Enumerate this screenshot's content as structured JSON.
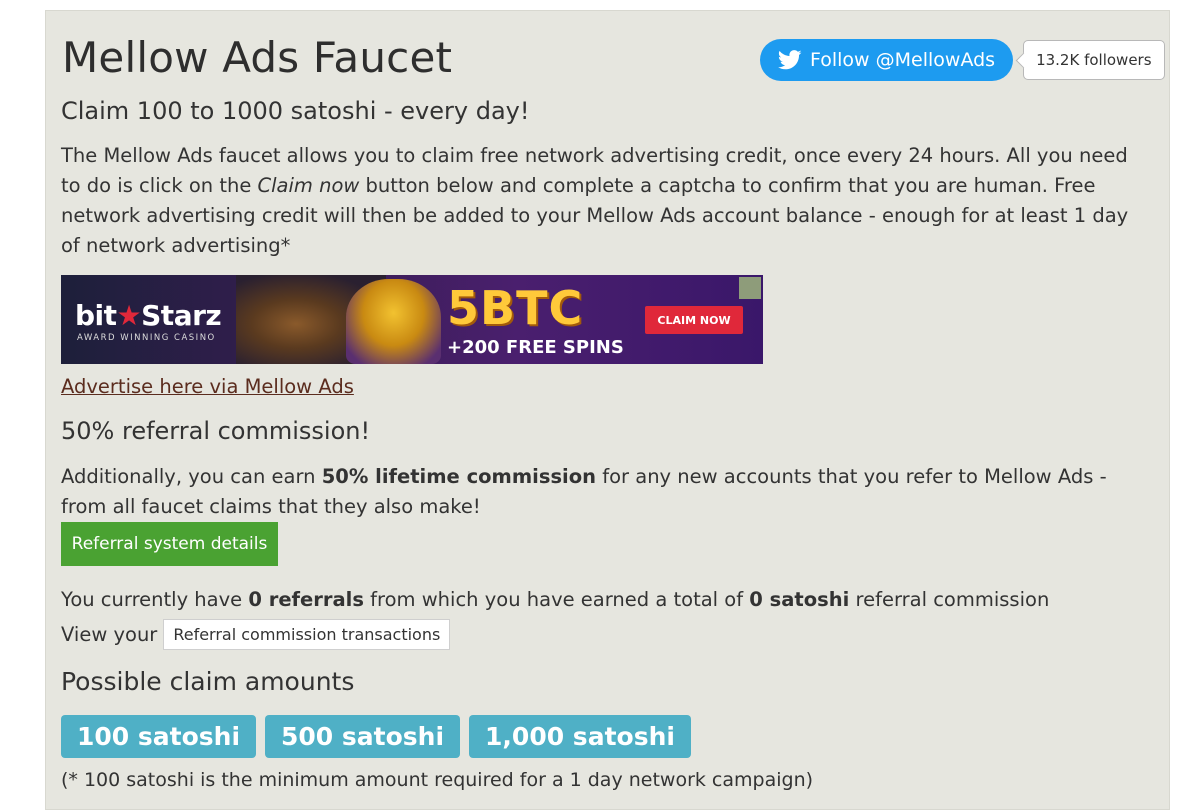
{
  "page": {
    "title": "Mellow Ads Faucet",
    "subtitle": "Claim 100 to 1000 satoshi - every day!"
  },
  "twitter": {
    "follow_label": "Follow @MellowAds",
    "followers": "13.2K followers",
    "icon": "twitter-bird-icon",
    "color": "#1d9bf0"
  },
  "intro": {
    "part1": "The Mellow Ads faucet allows you to claim free network advertising credit, once every 24 hours. All you need to do is click on the ",
    "claim_now": "Claim now",
    "part2": " button below and complete a captcha to confirm that you are human. Free network advertising credit will then be added to your Mellow Ads account balance - enough for at least 1 day of network advertising*"
  },
  "banner": {
    "brand_part1": "bit",
    "brand_star": "★",
    "brand_part2": "Starz",
    "tagline": "AWARD WINNING CASINO",
    "headline": "5BTC",
    "subline": "+200 FREE SPINS",
    "cta": "CLAIM NOW"
  },
  "advertise_link": "Advertise here via Mellow Ads",
  "referral": {
    "heading": "50% referral commission!",
    "text_before": "Additionally, you can earn ",
    "text_bold": "50% lifetime commission",
    "text_after": " for any new accounts that you refer to Mellow Ads - from all faucet claims that they also make!",
    "details_button": "Referral system details",
    "button_color": "#4aa232",
    "current_part1": "You currently have ",
    "current_referrals": "0 referrals",
    "current_part2": " from which you have earned a total of ",
    "current_satoshi": "0 satoshi",
    "current_part3": " referral commission",
    "view_label": "View your",
    "transactions_button": "Referral commission transactions"
  },
  "claims": {
    "heading": "Possible claim amounts",
    "amounts": [
      "100 satoshi",
      "500 satoshi",
      "1,000 satoshi"
    ],
    "badge_color": "#4fb0c6",
    "footnote": "(* 100 satoshi is the minimum amount required for a 1 day network campaign)"
  }
}
